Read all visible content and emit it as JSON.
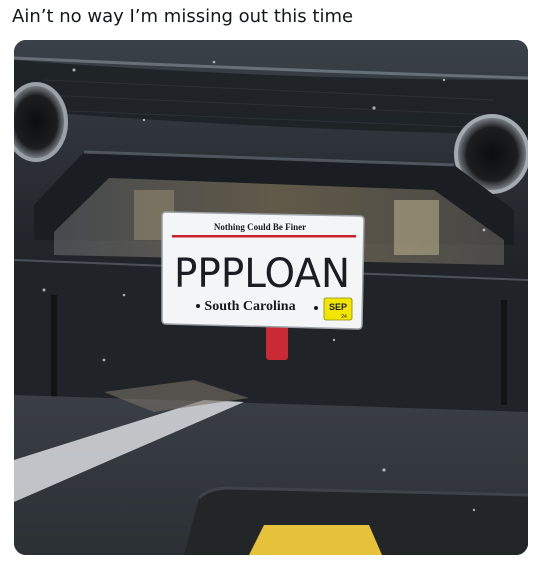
{
  "tweet": {
    "text": "Ain’t no way I’m missing out this time"
  },
  "photo": {
    "subject": "car-rear-with-license-plate",
    "plate": {
      "motto": "Nothing Could Be Finer",
      "number": "PPPLOAN",
      "state": "South Carolina",
      "sticker_month": "SEP",
      "sticker_year": "24",
      "sticker_color": "#f2e600",
      "plate_bg": "#f3f5f6",
      "number_color": "#1c1c22",
      "stripe_color": "#c8202a"
    }
  }
}
